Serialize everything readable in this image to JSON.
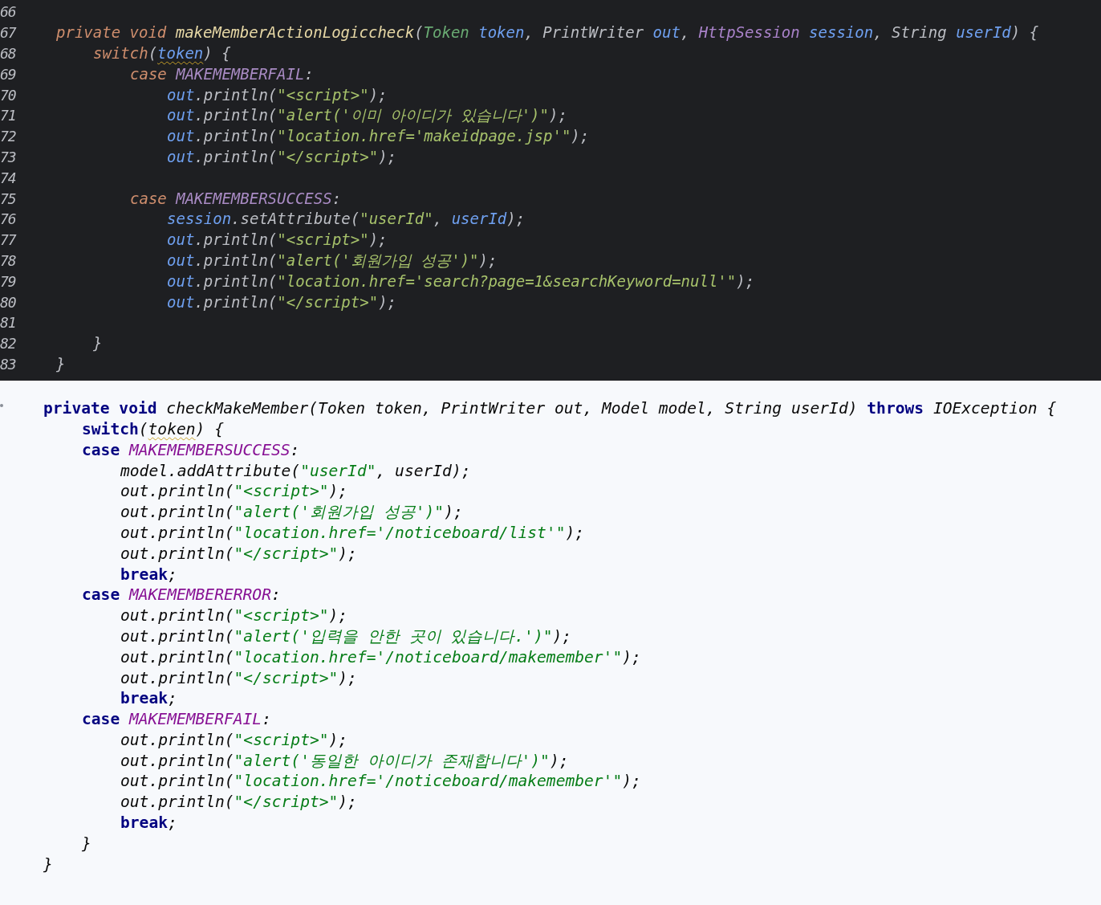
{
  "panels": [
    {
      "kind": "dark",
      "lines": [
        {
          "number": "66"
        },
        {
          "number": "67",
          "tokens": [
            {
              "kind": "keyword",
              "text": "private void "
            },
            {
              "kind": "method",
              "text": "makeMemberActionLogiccheck"
            },
            {
              "kind": "plain",
              "text": "("
            },
            {
              "kind": "type",
              "text": "Token "
            },
            {
              "kind": "param",
              "text": "token"
            },
            {
              "kind": "plain",
              "text": ", PrintWriter "
            },
            {
              "kind": "param",
              "text": "out"
            },
            {
              "kind": "plain",
              "text": ", "
            },
            {
              "kind": "interface",
              "text": "HttpSession "
            },
            {
              "kind": "param",
              "text": "session"
            },
            {
              "kind": "plain",
              "text": ", String "
            },
            {
              "kind": "param",
              "text": "userId"
            },
            {
              "kind": "plain",
              "text": ") {"
            }
          ],
          "children": [
            {
              "number": "68",
              "tokens": [
                {
                  "kind": "keyword",
                  "text": "switch"
                },
                {
                  "kind": "plain",
                  "text": "("
                },
                {
                  "kind": "param",
                  "text": "token",
                  "underlined": true
                },
                {
                  "kind": "plain",
                  "text": ") {"
                }
              ],
              "children": [
                {
                  "number": "69",
                  "tokens": [
                    {
                      "kind": "keyword",
                      "text": "case "
                    },
                    {
                      "kind": "constant",
                      "text": "MAKEMEMBERFAIL"
                    },
                    {
                      "kind": "plain",
                      "text": ":"
                    }
                  ],
                  "children": [
                    {
                      "number": "70",
                      "tokens": [
                        {
                          "kind": "param",
                          "text": "out"
                        },
                        {
                          "kind": "plain",
                          "text": ".println("
                        },
                        {
                          "kind": "string",
                          "text": "\"<script>\""
                        },
                        {
                          "kind": "plain",
                          "text": ");"
                        }
                      ]
                    },
                    {
                      "number": "71",
                      "tokens": [
                        {
                          "kind": "param",
                          "text": "out"
                        },
                        {
                          "kind": "plain",
                          "text": ".println("
                        },
                        {
                          "kind": "string",
                          "text": "\"alert('이미 아이디가 있습니다')\""
                        },
                        {
                          "kind": "plain",
                          "text": ");"
                        }
                      ]
                    },
                    {
                      "number": "72",
                      "tokens": [
                        {
                          "kind": "param",
                          "text": "out"
                        },
                        {
                          "kind": "plain",
                          "text": ".println("
                        },
                        {
                          "kind": "string",
                          "text": "\"location.href='makeidpage.jsp'\""
                        },
                        {
                          "kind": "plain",
                          "text": ");"
                        }
                      ]
                    },
                    {
                      "number": "73",
                      "tokens": [
                        {
                          "kind": "param",
                          "text": "out"
                        },
                        {
                          "kind": "plain",
                          "text": ".println("
                        },
                        {
                          "kind": "string",
                          "text": "\"</script>\""
                        },
                        {
                          "kind": "plain",
                          "text": ");"
                        }
                      ]
                    },
                    {
                      "number": "74"
                    }
                  ]
                },
                {
                  "number": "75",
                  "tokens": [
                    {
                      "kind": "keyword",
                      "text": "case "
                    },
                    {
                      "kind": "constant",
                      "text": "MAKEMEMBERSUCCESS"
                    },
                    {
                      "kind": "plain",
                      "text": ":"
                    }
                  ],
                  "children": [
                    {
                      "number": "76",
                      "tokens": [
                        {
                          "kind": "param",
                          "text": "session"
                        },
                        {
                          "kind": "plain",
                          "text": ".setAttribute("
                        },
                        {
                          "kind": "string",
                          "text": "\"userId\""
                        },
                        {
                          "kind": "plain",
                          "text": ", "
                        },
                        {
                          "kind": "param",
                          "text": "userId"
                        },
                        {
                          "kind": "plain",
                          "text": ");"
                        }
                      ]
                    },
                    {
                      "number": "77",
                      "tokens": [
                        {
                          "kind": "param",
                          "text": "out"
                        },
                        {
                          "kind": "plain",
                          "text": ".println("
                        },
                        {
                          "kind": "string",
                          "text": "\"<script>\""
                        },
                        {
                          "kind": "plain",
                          "text": ");"
                        }
                      ]
                    },
                    {
                      "number": "78",
                      "tokens": [
                        {
                          "kind": "param",
                          "text": "out"
                        },
                        {
                          "kind": "plain",
                          "text": ".println("
                        },
                        {
                          "kind": "string",
                          "text": "\"alert('회원가입 성공')\""
                        },
                        {
                          "kind": "plain",
                          "text": ");"
                        }
                      ]
                    },
                    {
                      "number": "79",
                      "tokens": [
                        {
                          "kind": "param",
                          "text": "out"
                        },
                        {
                          "kind": "plain",
                          "text": ".println("
                        },
                        {
                          "kind": "string",
                          "text": "\"location.href='search?page=1&searchKeyword=null'\""
                        },
                        {
                          "kind": "plain",
                          "text": ");"
                        }
                      ]
                    },
                    {
                      "number": "80",
                      "tokens": [
                        {
                          "kind": "param",
                          "text": "out"
                        },
                        {
                          "kind": "plain",
                          "text": ".println("
                        },
                        {
                          "kind": "string",
                          "text": "\"</script>\""
                        },
                        {
                          "kind": "plain",
                          "text": ");"
                        }
                      ]
                    },
                    {
                      "number": "81"
                    }
                  ]
                }
              ]
            },
            {
              "number": "82",
              "tokens": [
                {
                  "kind": "plain",
                  "text": "}"
                }
              ]
            }
          ]
        },
        {
          "number": "83",
          "tokens": [
            {
              "kind": "plain",
              "text": "}"
            }
          ]
        }
      ]
    },
    {
      "kind": "light",
      "lines": [
        {
          "tokens": [
            {
              "kind": "keyword",
              "text": "private void "
            },
            {
              "kind": "plain",
              "text": "checkMakeMember(Token token, PrintWriter out, Model model, String userId) "
            },
            {
              "kind": "keyword",
              "text": "throws "
            },
            {
              "kind": "plain",
              "text": "IOException {"
            }
          ],
          "children": [
            {
              "tokens": [
                {
                  "kind": "keyword",
                  "text": "switch"
                },
                {
                  "kind": "plain",
                  "text": "("
                },
                {
                  "kind": "plain",
                  "text": "token",
                  "underlined": true
                },
                {
                  "kind": "plain",
                  "text": ") {"
                }
              ]
            },
            {
              "tokens": [
                {
                  "kind": "keyword",
                  "text": "case "
                },
                {
                  "kind": "constant",
                  "text": "MAKEMEMBERSUCCESS"
                },
                {
                  "kind": "plain",
                  "text": ":"
                }
              ],
              "children": [
                {
                  "tokens": [
                    {
                      "kind": "plain",
                      "text": "model.addAttribute("
                    },
                    {
                      "kind": "string",
                      "text": "\"userId\""
                    },
                    {
                      "kind": "plain",
                      "text": ", userId);"
                    }
                  ]
                },
                {
                  "tokens": [
                    {
                      "kind": "plain",
                      "text": "out.println("
                    },
                    {
                      "kind": "string",
                      "text": "\"<script>\""
                    },
                    {
                      "kind": "plain",
                      "text": ");"
                    }
                  ]
                },
                {
                  "tokens": [
                    {
                      "kind": "plain",
                      "text": "out.println("
                    },
                    {
                      "kind": "string",
                      "text": "\"alert('회원가입 성공')\""
                    },
                    {
                      "kind": "plain",
                      "text": ");"
                    }
                  ]
                },
                {
                  "tokens": [
                    {
                      "kind": "plain",
                      "text": "out.println("
                    },
                    {
                      "kind": "string",
                      "text": "\"location.href='/noticeboard/list'\""
                    },
                    {
                      "kind": "plain",
                      "text": ");"
                    }
                  ]
                },
                {
                  "tokens": [
                    {
                      "kind": "plain",
                      "text": "out.println("
                    },
                    {
                      "kind": "string",
                      "text": "\"</script>\""
                    },
                    {
                      "kind": "plain",
                      "text": ");"
                    }
                  ]
                },
                {
                  "tokens": [
                    {
                      "kind": "keyword",
                      "text": "break"
                    },
                    {
                      "kind": "plain",
                      "text": ";"
                    }
                  ]
                }
              ]
            },
            {
              "tokens": [
                {
                  "kind": "keyword",
                  "text": "case "
                },
                {
                  "kind": "constant",
                  "text": "MAKEMEMBERERROR"
                },
                {
                  "kind": "plain",
                  "text": ":"
                }
              ],
              "children": [
                {
                  "tokens": [
                    {
                      "kind": "plain",
                      "text": "out.println("
                    },
                    {
                      "kind": "string",
                      "text": "\"<script>\""
                    },
                    {
                      "kind": "plain",
                      "text": ");"
                    }
                  ]
                },
                {
                  "tokens": [
                    {
                      "kind": "plain",
                      "text": "out.println("
                    },
                    {
                      "kind": "string",
                      "text": "\"alert('입력을 안한 곳이 있습니다.')\""
                    },
                    {
                      "kind": "plain",
                      "text": ");"
                    }
                  ]
                },
                {
                  "tokens": [
                    {
                      "kind": "plain",
                      "text": "out.println("
                    },
                    {
                      "kind": "string",
                      "text": "\"location.href='/noticeboard/makemember'\""
                    },
                    {
                      "kind": "plain",
                      "text": ");"
                    }
                  ]
                },
                {
                  "tokens": [
                    {
                      "kind": "plain",
                      "text": "out.println("
                    },
                    {
                      "kind": "string",
                      "text": "\"</script>\""
                    },
                    {
                      "kind": "plain",
                      "text": ");"
                    }
                  ]
                },
                {
                  "tokens": [
                    {
                      "kind": "keyword",
                      "text": "break"
                    },
                    {
                      "kind": "plain",
                      "text": ";"
                    }
                  ]
                }
              ]
            },
            {
              "tokens": [
                {
                  "kind": "keyword",
                  "text": "case "
                },
                {
                  "kind": "constant",
                  "text": "MAKEMEMBERFAIL"
                },
                {
                  "kind": "plain",
                  "text": ":"
                }
              ],
              "children": [
                {
                  "tokens": [
                    {
                      "kind": "plain",
                      "text": "out.println("
                    },
                    {
                      "kind": "string",
                      "text": "\"<script>\""
                    },
                    {
                      "kind": "plain",
                      "text": ");"
                    }
                  ]
                },
                {
                  "tokens": [
                    {
                      "kind": "plain",
                      "text": "out.println("
                    },
                    {
                      "kind": "string",
                      "text": "\"alert('동일한 아이디가 존재합니다')\""
                    },
                    {
                      "kind": "plain",
                      "text": ");"
                    }
                  ]
                },
                {
                  "tokens": [
                    {
                      "kind": "plain",
                      "text": "out.println("
                    },
                    {
                      "kind": "string",
                      "text": "\"location.href='/noticeboard/makemember'\""
                    },
                    {
                      "kind": "plain",
                      "text": ");"
                    }
                  ]
                },
                {
                  "tokens": [
                    {
                      "kind": "plain",
                      "text": "out.println("
                    },
                    {
                      "kind": "string",
                      "text": "\"</script>\""
                    },
                    {
                      "kind": "plain",
                      "text": ");"
                    }
                  ]
                },
                {
                  "tokens": [
                    {
                      "kind": "keyword",
                      "text": "break"
                    },
                    {
                      "kind": "plain",
                      "text": ";"
                    }
                  ]
                }
              ]
            },
            {
              "tokens": [
                {
                  "kind": "plain",
                  "text": "}"
                }
              ]
            }
          ]
        },
        {
          "tokens": [
            {
              "kind": "plain",
              "text": "}"
            }
          ]
        }
      ]
    }
  ]
}
